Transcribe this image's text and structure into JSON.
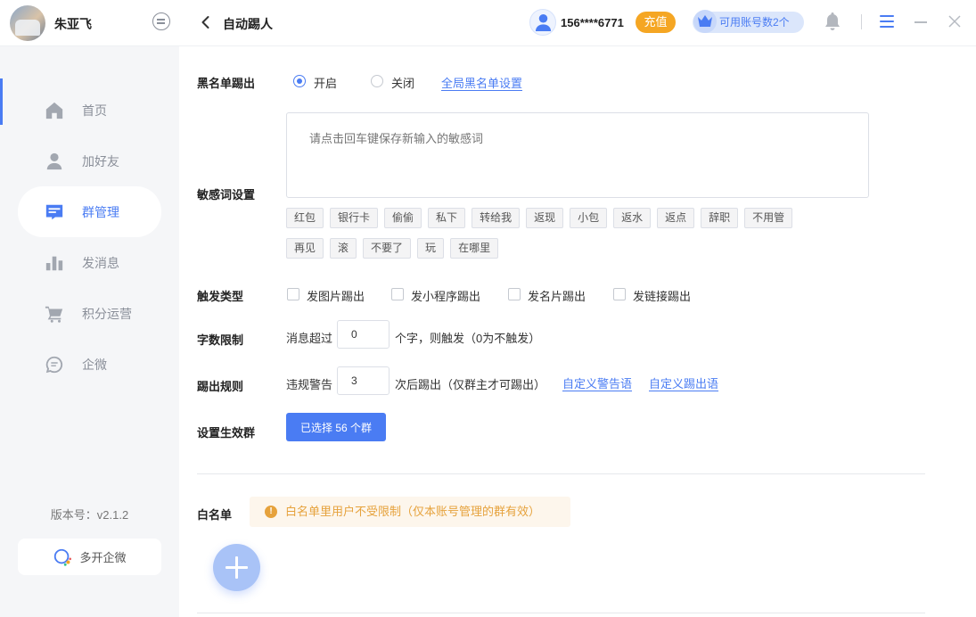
{
  "sidebar": {
    "user_name": "朱亚飞",
    "items": [
      {
        "label": "首页",
        "icon": "home-icon"
      },
      {
        "label": "加好友",
        "icon": "user-icon"
      },
      {
        "label": "群管理",
        "icon": "group-manage-icon"
      },
      {
        "label": "发消息",
        "icon": "message-chart-icon"
      },
      {
        "label": "积分运营",
        "icon": "cart-icon"
      },
      {
        "label": "企微",
        "icon": "chat-icon"
      }
    ],
    "active_index": 2,
    "version": "版本号：v2.1.2",
    "multi_open_label": "多开企微"
  },
  "topbar": {
    "title": "自动踢人",
    "phone": "156****6771",
    "recharge_label": "充值",
    "accounts_label": "可用账号数2个"
  },
  "blacklist": {
    "label": "黑名单踢出",
    "on_label": "开启",
    "off_label": "关闭",
    "selected": "on",
    "global_link": "全局黑名单设置"
  },
  "sensitive": {
    "label": "敏感词设置",
    "placeholder": "请点击回车键保存新输入的敏感词",
    "tags": [
      "红包",
      "银行卡",
      "偷偷",
      "私下",
      "转给我",
      "返现",
      "小包",
      "返水",
      "返点",
      "辞职",
      "不用管",
      "再见",
      "滚",
      "不要了",
      "玩",
      "在哪里"
    ]
  },
  "trigger": {
    "label": "触发类型",
    "options": [
      "发图片踢出",
      "发小程序踢出",
      "发名片踢出",
      "发链接踢出"
    ]
  },
  "char_limit": {
    "label": "字数限制",
    "prefix": "消息超过",
    "value": "0",
    "suffix": "个字，则触发（0为不触发）"
  },
  "kick_rule": {
    "label": "踢出规则",
    "prefix": "违规警告",
    "value": "3",
    "suffix": "次后踢出（仅群主才可踢出）",
    "warn_link": "自定义警告语",
    "kick_link": "自定义踢出语"
  },
  "effective_groups": {
    "label": "设置生效群",
    "button_label": "已选择 56 个群"
  },
  "whitelist": {
    "label": "白名单",
    "notice": "白名单里用户不受限制（仅本账号管理的群有效）"
  },
  "colors": {
    "accent": "#4a7cf3",
    "recharge": "#f5a623",
    "warning": "#e6a23c"
  }
}
